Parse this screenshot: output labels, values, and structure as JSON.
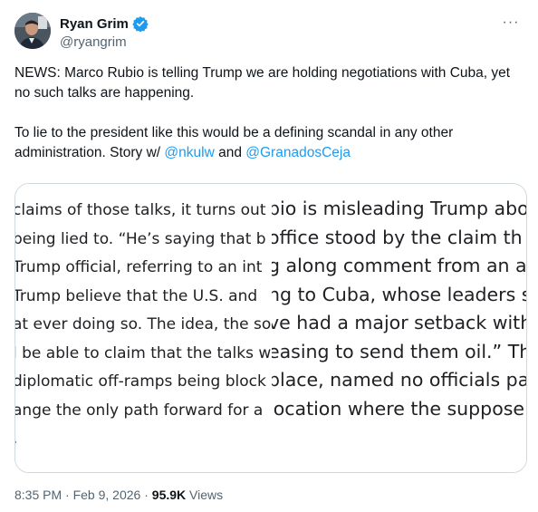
{
  "author": {
    "display_name": "Ryan Grim",
    "handle": "@ryangrim",
    "verified": true,
    "avatar_icon": "profile-photo"
  },
  "more_icon": "more-dots-icon",
  "more_glyph": "···",
  "tweet": {
    "para1": "NEWS: Marco Rubio is telling Trump we are holding negotiations with Cuba, yet no such talks are happening.",
    "para2_text": "To lie to the president like this would be a defining scandal in any other administration. Story w/ ",
    "mention1": "@nkulw",
    "and_text": " and ",
    "mention2": "@GranadosCeja"
  },
  "image": {
    "left_lines": [
      "claims of those talks, it turns out",
      "being lied to. “He’s saying that b",
      "Trump official, referring to an int",
      "Trump believe that the U.S. and",
      "at ever doing so. The idea, the so",
      "l be able to claim that the talks w",
      "diplomatic off-ramps being block",
      "ange the only path forward for a",
      "."
    ],
    "right_lines": [
      "bio is misleading Trump abou",
      "office stood by the claim th",
      "g along comment from an ac",
      "ng to Cuba, whose leaders s",
      "ve had a major setback with",
      "easing to send them oil.” Th",
      "place, named no officials pa",
      "location where the suppose"
    ]
  },
  "meta": {
    "time": "8:35 PM",
    "separator": " · ",
    "date": "Feb 9, 2026",
    "views_count": "95.9K",
    "views_label": " Views"
  },
  "colors": {
    "link": "#1d9bf0",
    "secondary_text": "#536471",
    "verified_badge": "#1d9bf0",
    "border": "#cfd9de"
  }
}
